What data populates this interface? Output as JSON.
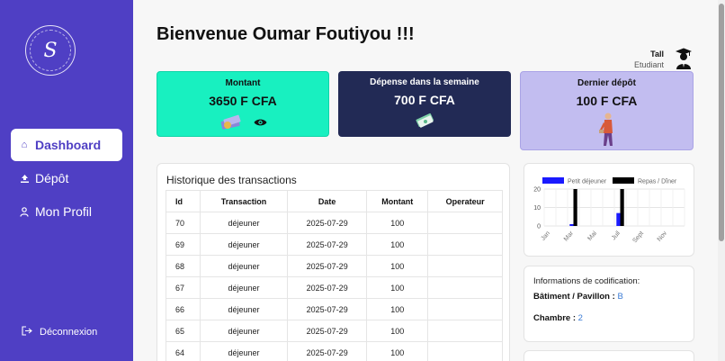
{
  "sidebar": {
    "logo_letter": "S",
    "items": [
      {
        "label": "Dashboard",
        "icon": "home-icon"
      },
      {
        "label": "Dépôt",
        "icon": "upload-icon"
      },
      {
        "label": "Mon Profil",
        "icon": "user-icon"
      }
    ],
    "logout_label": "Déconnexion"
  },
  "header": {
    "welcome": "Bienvenue Oumar Foutiyou !!!",
    "user_name": "Tall",
    "user_role": "Etudiant"
  },
  "cards": [
    {
      "title": "Montant",
      "value": "3650 F CFA",
      "bg": "#18f0c0"
    },
    {
      "title": "Dépense dans la semaine",
      "value": "700 F CFA",
      "bg": "#222a55"
    },
    {
      "title": "Dernier dépôt",
      "value": "100 F CFA",
      "bg": "#c2bdf0"
    }
  ],
  "transactions": {
    "title": "Historique des transactions",
    "columns": [
      "Id",
      "Transaction",
      "Date",
      "Montant",
      "Operateur"
    ],
    "rows": [
      [
        "70",
        "déjeuner",
        "2025-07-29",
        "100",
        ""
      ],
      [
        "69",
        "déjeuner",
        "2025-07-29",
        "100",
        ""
      ],
      [
        "68",
        "déjeuner",
        "2025-07-29",
        "100",
        ""
      ],
      [
        "67",
        "déjeuner",
        "2025-07-29",
        "100",
        ""
      ],
      [
        "66",
        "déjeuner",
        "2025-07-29",
        "100",
        ""
      ],
      [
        "65",
        "déjeuner",
        "2025-07-29",
        "100",
        ""
      ],
      [
        "64",
        "déjeuner",
        "2025-07-29",
        "100",
        ""
      ]
    ]
  },
  "chart_data": {
    "type": "bar",
    "categories": [
      "Jan",
      "Mar",
      "Mai",
      "Juil",
      "Sept",
      "Nov"
    ],
    "series": [
      {
        "name": "Petit déjeuner",
        "color": "#1a1aff",
        "values": [
          0,
          1,
          0,
          7,
          0,
          0
        ]
      },
      {
        "name": "Repas / Dîner",
        "color": "#000000",
        "values": [
          0,
          20,
          0,
          20,
          0,
          0
        ]
      }
    ],
    "ylim": [
      0,
      20
    ],
    "yticks": [
      "0",
      "10",
      "20"
    ],
    "grid": true,
    "legend": "top"
  },
  "info": {
    "title": "Informations de codification:",
    "batiment_label": "Bâtiment / Pavillon :",
    "batiment_value": "B",
    "chambre_label": "Chambre :",
    "chambre_value": "2"
  }
}
